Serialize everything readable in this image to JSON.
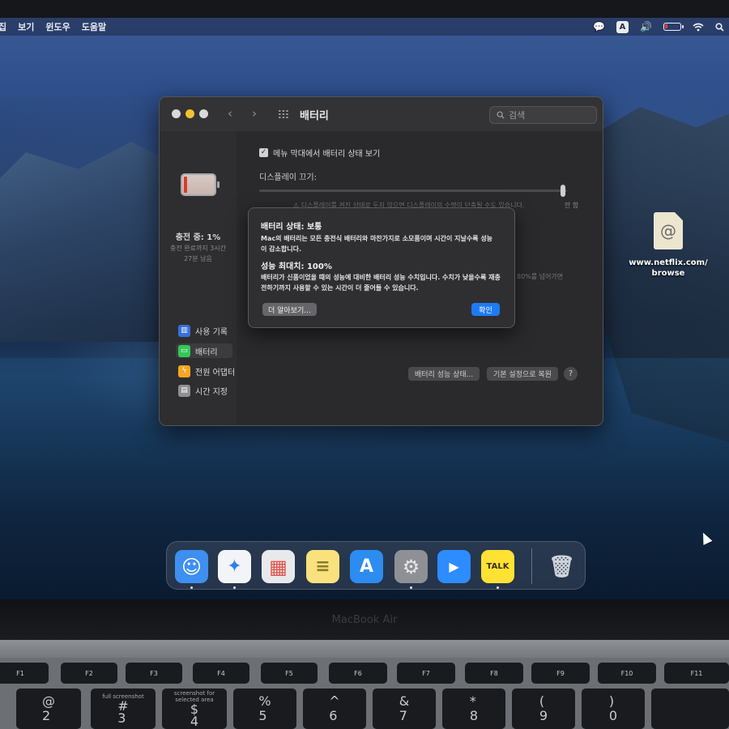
{
  "menubar": {
    "items": [
      "집",
      "보기",
      "윈도우",
      "도움말"
    ],
    "ime_label": "A"
  },
  "desktop_file": {
    "name": "www.netflix.com/\nbrowse",
    "glyph": "@"
  },
  "window": {
    "title": "배터리",
    "search_placeholder": "검색",
    "sidebar": {
      "charge_status": "충전 중: 1%",
      "charge_note": "충전 완료까지 3시간\n27분 남음",
      "items": [
        {
          "label": "사용 기록",
          "icon": "chart-icon",
          "color": "#3a6fd8"
        },
        {
          "label": "배터리",
          "icon": "battery-icon",
          "color": "#34c759"
        },
        {
          "label": "전원 어댑터",
          "icon": "bolt-icon",
          "color": "#f5a623"
        },
        {
          "label": "시간 지정",
          "icon": "calendar-icon",
          "color": "#8e8e93"
        }
      ]
    },
    "content": {
      "menubar_checkbox_label": "메뉴 막대에서 배터리 상태 보기",
      "display_off_label": "디스플레이 끄기:",
      "slider_end_label": "안 함",
      "dimmed_hint": "⚠ 디스플레이를 켜진 상태로 두지 않으면 디스플레이의 수명이 단축될 수도 있습니다.",
      "dimmed_80": "80%를 넘어가면",
      "buttons": {
        "health": "배터리 성능 상태...",
        "restore": "기본 설정으로 복원",
        "help": "?"
      }
    }
  },
  "dialog": {
    "title1": "배터리 상태: 보통",
    "body1": "Mac의 배터리는 모든 충전식 배터리와 마찬가지로 소모품이며 시간이 지날수록 성능이 감소합니다.",
    "title2": "성능 최대치: 100%",
    "body2": "배터리가 신품이었을 때의 성능에 대비한 배터리 성능 수치입니다. 수치가 낮을수록 재충전하기까지 사용할 수 있는 시간이 더 줄어들 수 있습니다.",
    "learn_more": "더 알아보기...",
    "ok": "확인"
  },
  "dock": {
    "apps": [
      {
        "name": "finder",
        "glyph": "☺",
        "bg": "#3d8ff0",
        "fg": "#ffffff",
        "running": true
      },
      {
        "name": "safari",
        "glyph": "✦",
        "bg": "#f2f4f7",
        "fg": "#2f7ef0",
        "running": true
      },
      {
        "name": "launchpad",
        "glyph": "▦",
        "bg": "#e9e9ec",
        "fg": "#e0524a",
        "running": false
      },
      {
        "name": "notes",
        "glyph": "≡",
        "bg": "#f9e27d",
        "fg": "#8d7a2c",
        "running": false
      },
      {
        "name": "app-store",
        "glyph": "A",
        "bg": "#2d8cf0",
        "fg": "#ffffff",
        "running": false
      },
      {
        "name": "system-preferences",
        "glyph": "⚙",
        "bg": "#8e9096",
        "fg": "#e6e6e6",
        "running": true
      },
      {
        "name": "zoom",
        "glyph": "▶",
        "bg": "#2d8cff",
        "fg": "#ffffff",
        "running": false
      },
      {
        "name": "kakaotalk",
        "glyph": "TALK",
        "bg": "#ffe233",
        "fg": "#3a2b1d",
        "running": true
      },
      {
        "name": "trash",
        "glyph": "🗑",
        "bg": "transparent",
        "fg": "#cfd3da",
        "running": false
      }
    ]
  },
  "hardware": {
    "brand": "MacBook Air",
    "fkeys": [
      "F1",
      "F2",
      "F3",
      "F4",
      "F5",
      "F6",
      "F7",
      "F8",
      "F9",
      "F10",
      "F11"
    ],
    "number_keys": [
      {
        "main": "@\n2",
        "sub": ""
      },
      {
        "main": "#\n3",
        "sub": "full screenshot"
      },
      {
        "main": "$\n4",
        "sub": "screenshot for selected area"
      },
      {
        "main": "%\n5",
        "sub": ""
      },
      {
        "main": "^\n6",
        "sub": ""
      },
      {
        "main": "&\n7",
        "sub": ""
      },
      {
        "main": "*\n8",
        "sub": ""
      },
      {
        "main": "(\n9",
        "sub": ""
      },
      {
        "main": ")\n0",
        "sub": ""
      }
    ]
  }
}
